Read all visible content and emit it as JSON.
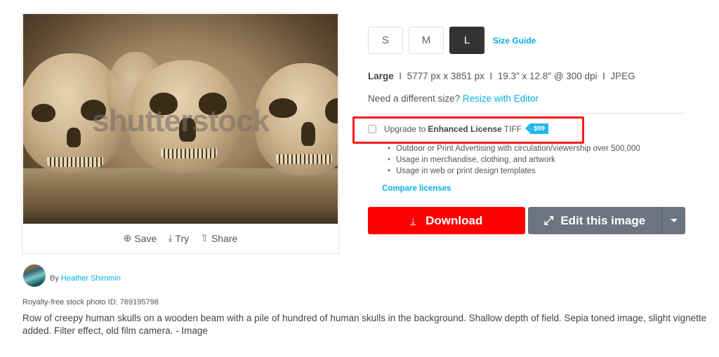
{
  "image": {
    "watermark": "shutterstock",
    "actions": [
      {
        "icon": "⊕",
        "label": "Save"
      },
      {
        "icon": "⤓",
        "label": "Try"
      },
      {
        "icon": "⇧",
        "label": "Share"
      }
    ]
  },
  "sizes": {
    "options": [
      "S",
      "M",
      "L"
    ],
    "selected": "L",
    "guide_label": "Size Guide"
  },
  "spec": {
    "size_name": "Large",
    "separator": "I",
    "pixels": "5777 px x 3851 px",
    "inches": "19.3″ x 12.8″ @ 300 dpi",
    "format": "JPEG"
  },
  "resize": {
    "prompt": "Need a different size?",
    "link": "Resize with Editor"
  },
  "upgrade": {
    "prefix": "Upgrade to",
    "license": "Enhanced License",
    "format": "TIFF",
    "price": "$99",
    "checked": false,
    "features": [
      "Outdoor or Print Advertising with circulation/viewership over 500,000",
      "Usage in merchandise, clothing, and artwork",
      "Usage in web or print design templates"
    ],
    "compare_label": "Compare licenses"
  },
  "buttons": {
    "download_label": "Download",
    "download_icon": "↓",
    "edit_label": "Edit this image",
    "edit_icon": "⤢"
  },
  "author": {
    "prefix": "By",
    "name": "Heather Shimmin"
  },
  "photo_id": "Royalty-free stock photo ID: 769195798",
  "description": "Row of creepy human skulls on a wooden beam with a pile of hundred of human skulls in the background. Shallow depth of field. Sepia toned image, slight vignette added. Filter effect, old film camera. - Image",
  "colors": {
    "accent_link": "#00b2e3",
    "download": "#ff0000",
    "edit": "#6d7480",
    "highlight_box": "#ff1a1a",
    "price_tag": "#22b8ea"
  }
}
